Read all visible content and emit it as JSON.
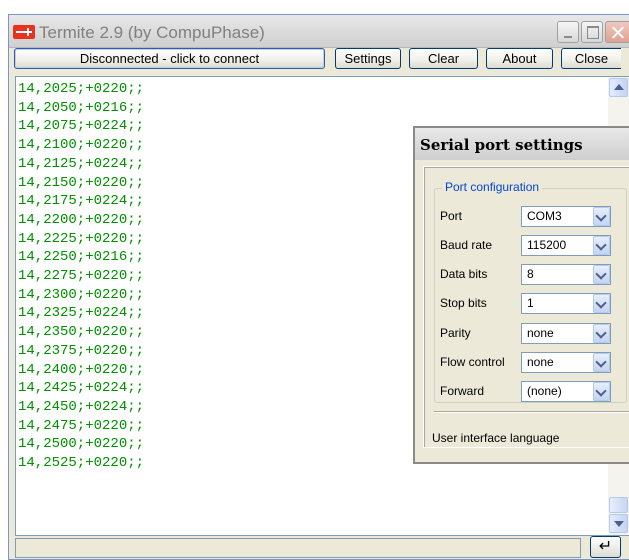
{
  "window": {
    "title": "Termite 2.9 (by CompuPhase)"
  },
  "toolbar": {
    "connect_label": "Disconnected - click to connect",
    "settings_label": "Settings",
    "clear_label": "Clear",
    "about_label": "About",
    "close_label": "Close"
  },
  "terminal": {
    "lines": [
      "14,2025;+0220;;",
      "14,2050;+0216;;",
      "14,2075;+0224;;",
      "14,2100;+0220;;",
      "14,2125;+0224;;",
      "14,2150;+0220;;",
      "14,2175;+0224;;",
      "14,2200;+0220;;",
      "14,2225;+0220;;",
      "14,2250;+0216;;",
      "14,2275;+0220;;",
      "14,2300;+0220;;",
      "14,2325;+0224;;",
      "14,2350;+0220;;",
      "14,2375;+0220;;",
      "14,2400;+0220;;",
      "14,2425;+0224;;",
      "14,2450;+0224;;",
      "14,2475;+0220;;",
      "14,2500;+0220;;",
      "14,2525;+0220;;"
    ],
    "text_color": "#009000"
  },
  "input": {
    "value": "",
    "send_icon": "↵"
  },
  "settings_dialog": {
    "title": "Serial port settings",
    "group_label": "Port configuration",
    "port_label": "Port",
    "port_value": "COM3",
    "baud_label": "Baud rate",
    "baud_value": "115200",
    "data_bits_label": "Data bits",
    "data_bits_value": "8",
    "stop_bits_label": "Stop bits",
    "stop_bits_value": "1",
    "parity_label": "Parity",
    "parity_value": "none",
    "flow_label": "Flow control",
    "flow_value": "none",
    "forward_label": "Forward",
    "forward_value": "(none)",
    "language_label": "User interface language"
  }
}
